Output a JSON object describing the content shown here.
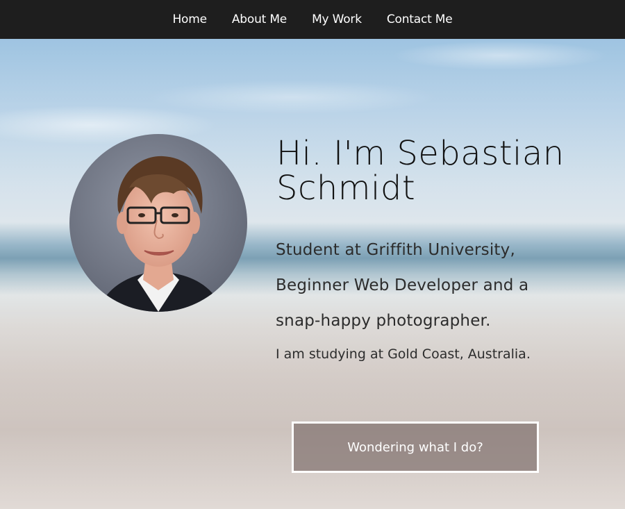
{
  "nav": {
    "items": [
      {
        "label": "Home"
      },
      {
        "label": "About Me"
      },
      {
        "label": "My Work"
      },
      {
        "label": "Contact Me"
      }
    ]
  },
  "hero": {
    "headline": "Hi. I'm Sebastian Schmidt",
    "tagline": "Student at Griffith University, Beginner Web Developer and a snap-happy photographer.",
    "location": "I am studying at Gold Coast, Australia.",
    "cta_label": "Wondering what I do?",
    "avatar_icon": "profile-photo"
  },
  "colors": {
    "nav_background": "#1e1e1e",
    "nav_text": "#ffffff",
    "headline_text": "#111111",
    "body_text": "#2c2c2c",
    "cta_border": "#ffffff",
    "cta_background": "#827370"
  }
}
